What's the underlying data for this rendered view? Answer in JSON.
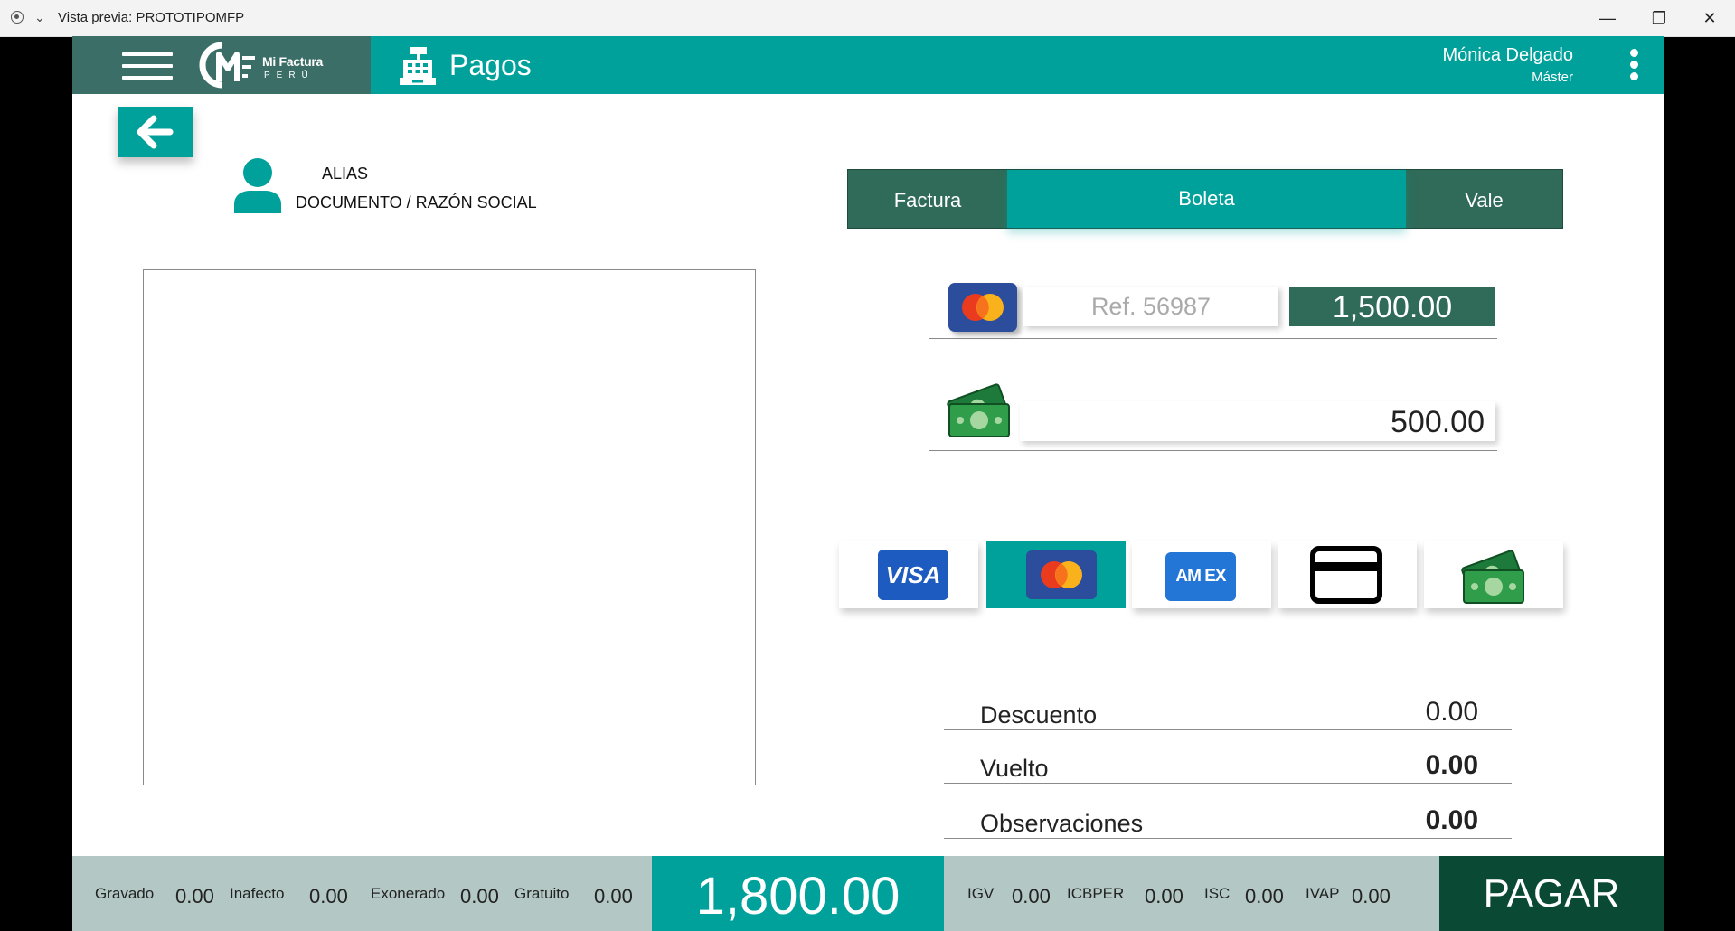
{
  "window": {
    "title": "Vista previa: PROTOTIPOMFP",
    "minimize": "—",
    "restore": "❐",
    "close": "✕"
  },
  "header": {
    "brand_line1": "Mi Factura",
    "brand_line2": "PERÚ",
    "title": "Pagos",
    "user_name": "Mónica Delgado",
    "user_role": "Máster"
  },
  "customer": {
    "alias": "ALIAS",
    "document": "DOCUMENTO / RAZÓN SOCIAL"
  },
  "doc_types": {
    "items": [
      "Factura",
      "Boleta",
      "Vale"
    ],
    "selected": "Boleta"
  },
  "payments": [
    {
      "method_icon": "mastercard-icon",
      "reference_placeholder": "Ref. 56987",
      "amount": "1,500.00"
    },
    {
      "method_icon": "cash-icon",
      "amount": "500.00"
    }
  ],
  "methods": {
    "items": [
      {
        "name": "visa",
        "label": "VISA"
      },
      {
        "name": "mastercard",
        "label": ""
      },
      {
        "name": "amex",
        "label": "AM EX"
      },
      {
        "name": "card",
        "label": ""
      },
      {
        "name": "cash",
        "label": ""
      }
    ],
    "selected": "mastercard"
  },
  "summary": [
    {
      "label": "Descuento",
      "value": "0.00"
    },
    {
      "label": "Vuelto",
      "value": "0.00"
    },
    {
      "label": "Observaciones",
      "value": "0.00"
    }
  ],
  "footer": {
    "gravado_label": "Gravado",
    "gravado": "0.00",
    "inafecto_label": "Inafecto",
    "inafecto": "0.00",
    "exonerado_label": "Exonerado",
    "exonerado": "0.00",
    "gratuito_label": "Gratuito",
    "gratuito": "0.00",
    "total": "1,800.00",
    "igv_label": "IGV",
    "igv": "0.00",
    "icbper_label": "ICBPER",
    "icbper": "0.00",
    "isc_label": "ISC",
    "isc": "0.00",
    "ivap_label": "IVAP",
    "ivap": "0.00",
    "pay_label": "PAGAR"
  },
  "colors": {
    "teal": "#00a19b",
    "dark_green": "#2f6b58",
    "brand_bg": "#3c6e68",
    "pay_button": "#0a4a35",
    "footer_bg": "#b3c8c5"
  }
}
